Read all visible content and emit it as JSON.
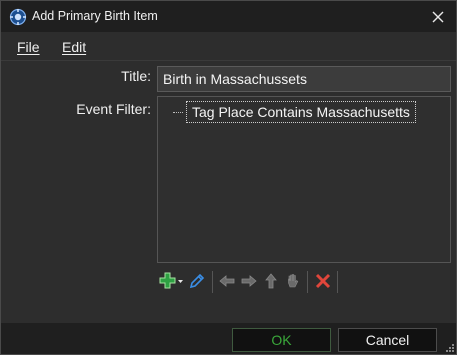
{
  "window": {
    "title": "Add Primary Birth Item"
  },
  "menu": {
    "file": "File",
    "edit": "Edit"
  },
  "form": {
    "title_label": "Title:",
    "title_value": "Birth in Massachussets",
    "event_filter_label": "Event Filter:",
    "filter_items": [
      {
        "label": "Tag Place Contains Massachusetts"
      }
    ]
  },
  "toolbar": {
    "icons": [
      "add-icon",
      "edit-pencil-icon",
      "arrow-left-icon",
      "arrow-right-icon",
      "arrow-up-icon",
      "hand-icon",
      "delete-icon"
    ]
  },
  "buttons": {
    "ok": "OK",
    "cancel": "Cancel"
  },
  "colors": {
    "ok_text": "#3aa83a",
    "add_green": "#2ea043",
    "delete_red": "#e0463b",
    "edit_blue": "#3a8ee6"
  }
}
